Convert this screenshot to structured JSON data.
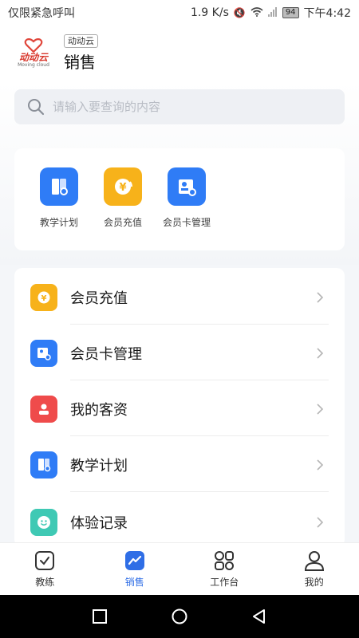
{
  "status_bar": {
    "carrier": "仅限紧急呼叫",
    "speed": "1.9 K/s",
    "battery": "94",
    "time": "下午4:42"
  },
  "header": {
    "logo_text": "动动云",
    "logo_sub": "Moving cloud",
    "brand_badge": "动动云",
    "title": "销售"
  },
  "search": {
    "placeholder": "请输入要查询的内容",
    "icon": "search-icon"
  },
  "quick_actions": [
    {
      "label": "教学计划",
      "icon": "teaching-plan-icon",
      "color": "#2f7cf6"
    },
    {
      "label": "会员充值",
      "icon": "member-recharge-icon",
      "color": "#f7b21a"
    },
    {
      "label": "会员卡管理",
      "icon": "member-card-icon",
      "color": "#2f7cf6"
    }
  ],
  "menu_items": [
    {
      "label": "会员充值",
      "icon": "member-recharge-icon",
      "color": "#f7b21a"
    },
    {
      "label": "会员卡管理",
      "icon": "member-card-icon",
      "color": "#2f7cf6"
    },
    {
      "label": "我的客资",
      "icon": "customer-icon",
      "color": "#ef4b4b"
    },
    {
      "label": "教学计划",
      "icon": "teaching-plan-icon",
      "color": "#2f7cf6"
    },
    {
      "label": "体验记录",
      "icon": "experience-record-icon",
      "color": "#3fc9b4"
    }
  ],
  "bottom_nav": [
    {
      "label": "教练",
      "icon": "coach-icon",
      "active": false
    },
    {
      "label": "销售",
      "icon": "sales-icon",
      "active": true
    },
    {
      "label": "工作台",
      "icon": "workbench-icon",
      "active": false
    },
    {
      "label": "我的",
      "icon": "profile-icon",
      "active": false
    }
  ],
  "colors": {
    "accent": "#2f6ee6",
    "background": "#f4f6f9"
  }
}
